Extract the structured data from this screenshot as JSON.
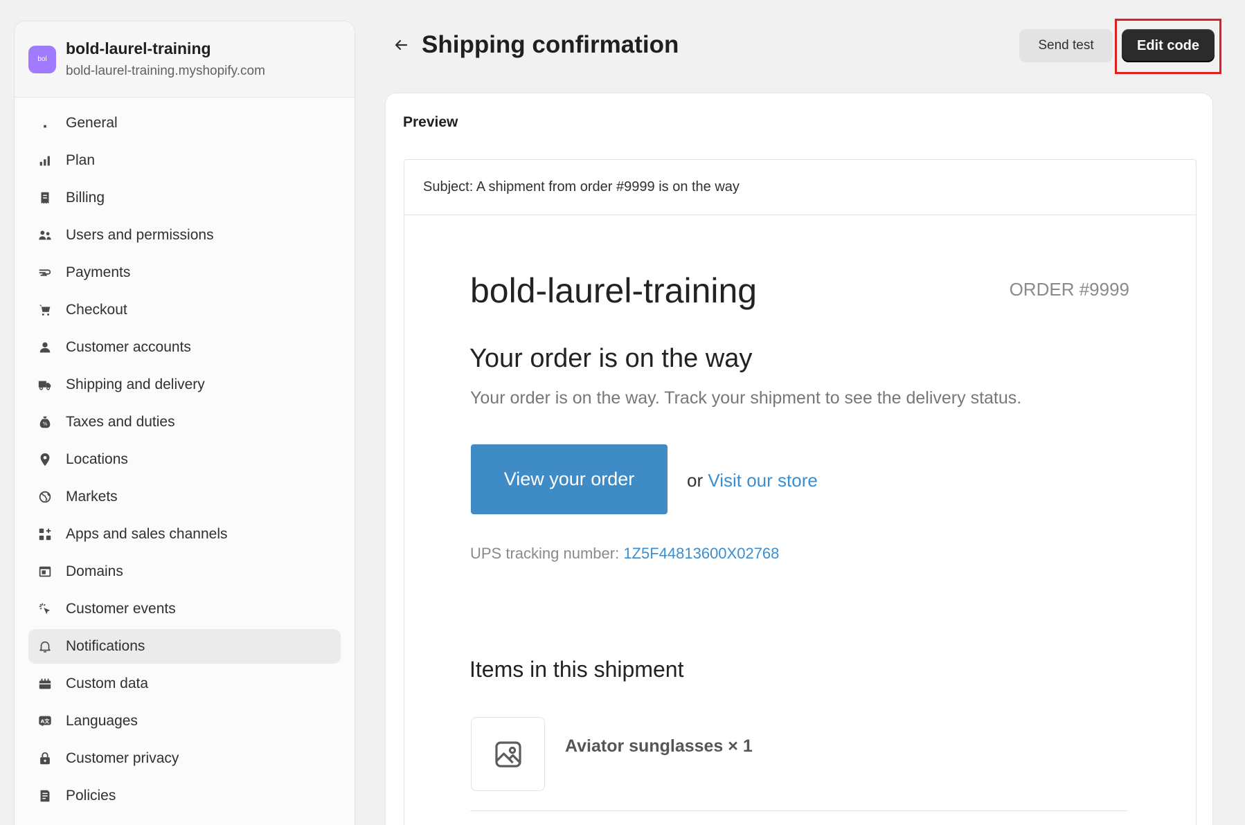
{
  "store": {
    "avatar_text": "bol",
    "name": "bold-laurel-training",
    "domain": "bold-laurel-training.myshopify.com"
  },
  "sidebar": {
    "items": [
      {
        "label": "General",
        "icon": "store-icon"
      },
      {
        "label": "Plan",
        "icon": "plan-icon"
      },
      {
        "label": "Billing",
        "icon": "receipt-icon"
      },
      {
        "label": "Users and permissions",
        "icon": "users-icon"
      },
      {
        "label": "Payments",
        "icon": "payments-icon"
      },
      {
        "label": "Checkout",
        "icon": "cart-icon"
      },
      {
        "label": "Customer accounts",
        "icon": "person-icon"
      },
      {
        "label": "Shipping and delivery",
        "icon": "truck-icon"
      },
      {
        "label": "Taxes and duties",
        "icon": "tax-icon"
      },
      {
        "label": "Locations",
        "icon": "location-pin-icon"
      },
      {
        "label": "Markets",
        "icon": "globe-icon"
      },
      {
        "label": "Apps and sales channels",
        "icon": "apps-icon"
      },
      {
        "label": "Domains",
        "icon": "domain-icon"
      },
      {
        "label": "Customer events",
        "icon": "cursor-click-icon"
      },
      {
        "label": "Notifications",
        "icon": "bell-icon",
        "active": true
      },
      {
        "label": "Custom data",
        "icon": "custom-data-icon"
      },
      {
        "label": "Languages",
        "icon": "language-icon"
      },
      {
        "label": "Customer privacy",
        "icon": "lock-icon"
      },
      {
        "label": "Policies",
        "icon": "policy-icon"
      }
    ]
  },
  "header": {
    "title": "Shipping confirmation",
    "send_test_label": "Send test",
    "edit_code_label": "Edit code"
  },
  "preview": {
    "label": "Preview",
    "subject": "Subject: A shipment from order #9999 is on the way",
    "shop_name": "bold-laurel-training",
    "order_number": "ORDER #9999",
    "headline": "Your order is on the way",
    "subtext": "Your order is on the way. Track your shipment to see the delivery status.",
    "view_order_label": "View your order",
    "or_text": "or ",
    "visit_store_label": "Visit our store",
    "tracking_label": "UPS tracking number: ",
    "tracking_number": "1Z5F44813600X02768",
    "items_title": "Items in this shipment",
    "item_name": "Aviator sunglasses × 1"
  },
  "colors": {
    "accent_button": "#3f8bc6",
    "link": "#3b8ed0",
    "highlight": "#e0201c"
  }
}
